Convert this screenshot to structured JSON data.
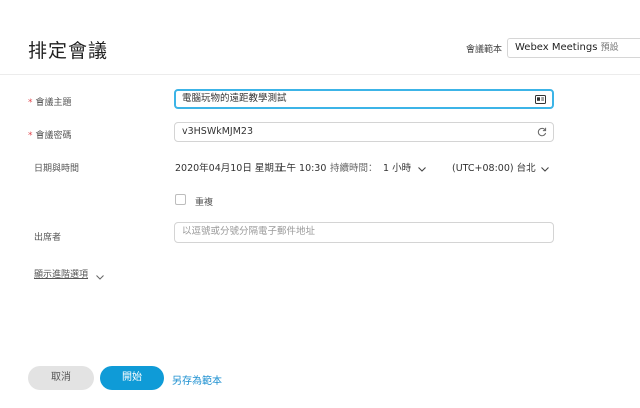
{
  "page": {
    "title": "排定會議",
    "template_label": "會議範本",
    "template_value": "Webex Meetings",
    "template_suffix": "預設"
  },
  "form": {
    "topic": {
      "label": "會議主題",
      "value": "電腦玩物的遠距教學測試",
      "required_mark": "*"
    },
    "password": {
      "label": "會議密碼",
      "value": "v3HSWkMJM23",
      "required_mark": "*"
    },
    "datetime": {
      "label": "日期與時間",
      "date": "2020年04月10日 星期五",
      "time": "上午 10:30",
      "duration_label": "持續時間：",
      "duration_value": "1 小時",
      "timezone": "(UTC+08:00) 台北"
    },
    "repeat": {
      "label": "重複",
      "checked": false
    },
    "attendees": {
      "label": "出席者",
      "placeholder": "以逗號或分號分隔電子郵件地址"
    },
    "advanced": {
      "label": "顯示進階選項"
    }
  },
  "footer": {
    "cancel_label": "取消",
    "start_label": "開始",
    "save_template_label": "另存為範本"
  },
  "colors": {
    "accent": "#0f9bd7",
    "focus_border": "#3cb4e7",
    "required": "#e0474f",
    "link": "#1b8fd0"
  }
}
